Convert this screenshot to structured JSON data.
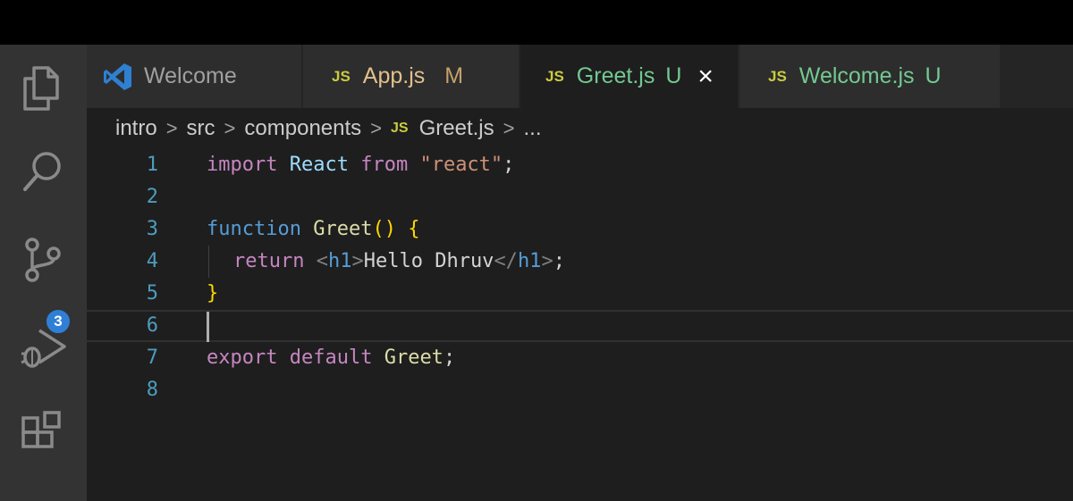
{
  "activity_bar": {
    "items": [
      {
        "icon": "files-icon"
      },
      {
        "icon": "search-icon"
      },
      {
        "icon": "source-control-icon",
        "badge": "3"
      },
      {
        "icon": "run-debug-icon"
      },
      {
        "icon": "extensions-icon"
      }
    ],
    "badge_color": "#2f7fd7"
  },
  "tabs": [
    {
      "icon": "vscode-logo-icon",
      "label": "Welcome",
      "status": "",
      "color": "#a0a0a0",
      "active": false
    },
    {
      "icon": "JS",
      "label": "App.js",
      "status": "M",
      "color": "#e2c08d",
      "active": false
    },
    {
      "icon": "JS",
      "label": "Greet.js",
      "status": "U",
      "color": "#73c991",
      "active": true
    },
    {
      "icon": "JS",
      "label": "Welcome.js",
      "status": "U",
      "color": "#73c991",
      "active": false
    }
  ],
  "breadcrumb": {
    "items": [
      "intro",
      "src",
      "components",
      "Greet.js",
      "..."
    ],
    "file_icon": "JS"
  },
  "editor": {
    "line_numbers": [
      "1",
      "2",
      "3",
      "4",
      "5",
      "6",
      "7",
      "8"
    ],
    "current_line": "6",
    "lines": {
      "l1": {
        "import": "import",
        "React": "React",
        "from": "from",
        "str": "\"react\"",
        "semi": ";"
      },
      "l3": {
        "function": "function",
        "name": "Greet",
        "parens": "()",
        "brace": "{"
      },
      "l4": {
        "return": "return",
        "lt1": "<",
        "tag1": "h1",
        "gt1": ">",
        "text": "Hello Dhruv",
        "lt2": "</",
        "tag2": "h1",
        "gt2": ">",
        "semi": ";"
      },
      "l5": {
        "brace": "}"
      },
      "l7": {
        "export": "export",
        "default": "default",
        "name": "Greet",
        "semi": ";"
      }
    }
  }
}
